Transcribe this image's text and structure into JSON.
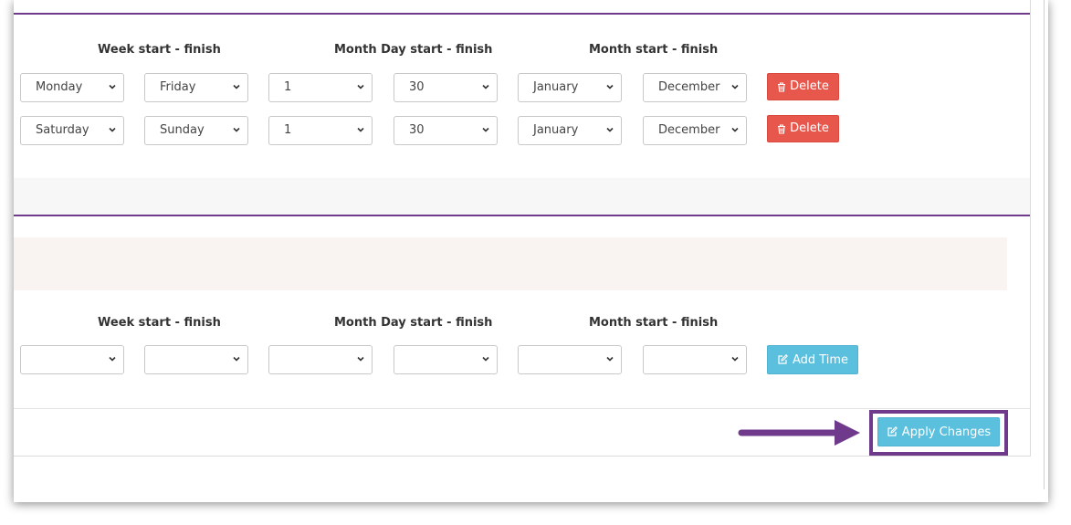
{
  "schedule": {
    "headers": {
      "week": "Week start - finish",
      "month_day": "Month Day start - finish",
      "month": "Month start - finish"
    },
    "rows": [
      {
        "week_start": "Monday",
        "week_finish": "Friday",
        "day_start": "1",
        "day_finish": "30",
        "month_start": "January",
        "month_finish": "December",
        "delete_label": "Delete"
      },
      {
        "week_start": "Saturday",
        "week_finish": "Sunday",
        "day_start": "1",
        "day_finish": "30",
        "month_start": "January",
        "month_finish": "December",
        "delete_label": "Delete"
      }
    ]
  },
  "add_time": {
    "headers": {
      "week": "Week start - finish",
      "month_day": "Month Day start - finish",
      "month": "Month start - finish"
    },
    "week_start": "",
    "week_finish": "",
    "day_start": "",
    "day_finish": "",
    "month_start": "",
    "month_finish": "",
    "button_label": "Add Time"
  },
  "footer": {
    "apply_label": "Apply Changes"
  },
  "colors": {
    "delete": "#e8574b",
    "info": "#5bc0de",
    "highlight": "#6f3a8c"
  },
  "icons": {
    "delete": "trash-icon",
    "add": "edit-icon",
    "apply": "edit-icon",
    "annotation": "arrow-right-icon"
  }
}
